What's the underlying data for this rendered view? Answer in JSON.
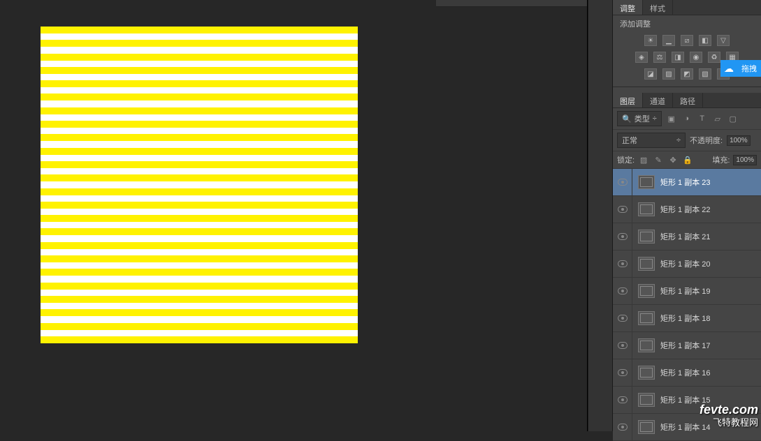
{
  "adjustments": {
    "tabs": [
      "调整",
      "样式"
    ],
    "title": "添加调整"
  },
  "drag_badge": {
    "label": "拖拽"
  },
  "layers_panel": {
    "tabs": [
      "图层",
      "通道",
      "路径"
    ],
    "filter": {
      "label": "类型",
      "icon_glyph": "🔍"
    },
    "blend_mode": "正常",
    "opacity_label": "不透明度:",
    "opacity_value": "100%",
    "lock_label": "锁定:",
    "fill_label": "填充:",
    "fill_value": "100%",
    "layers": [
      {
        "name": "矩形 1 副本 23",
        "selected": true
      },
      {
        "name": "矩形 1 副本 22",
        "selected": false
      },
      {
        "name": "矩形 1 副本 21",
        "selected": false
      },
      {
        "name": "矩形 1 副本 20",
        "selected": false
      },
      {
        "name": "矩形 1 副本 19",
        "selected": false
      },
      {
        "name": "矩形 1 副本 18",
        "selected": false
      },
      {
        "name": "矩形 1 副本 17",
        "selected": false
      },
      {
        "name": "矩形 1 副本 16",
        "selected": false
      },
      {
        "name": "矩形 1 副本 15",
        "selected": false
      },
      {
        "name": "矩形 1 副本 14",
        "selected": false
      }
    ]
  },
  "watermark": {
    "line1": "fevte.com",
    "line2": "飞特教程网"
  }
}
